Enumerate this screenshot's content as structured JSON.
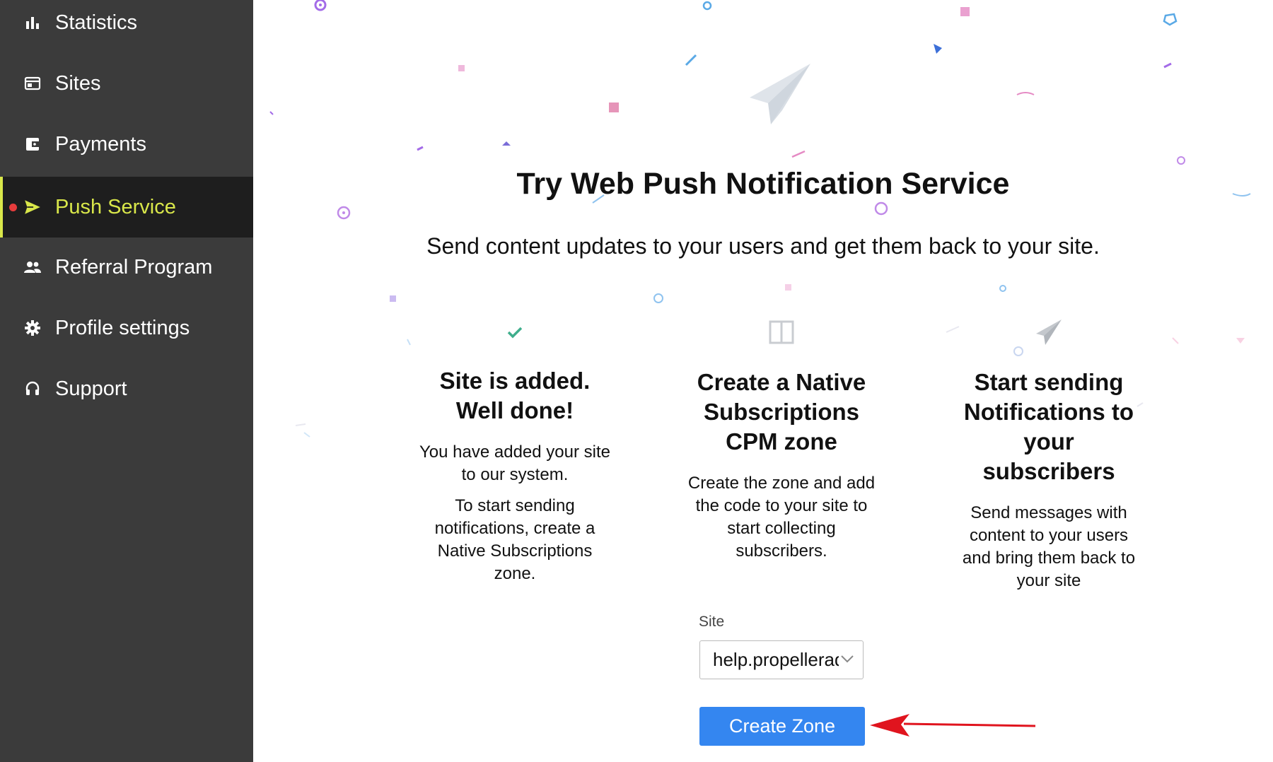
{
  "sidebar": {
    "items": [
      {
        "label": "Statistics",
        "icon": "bar-chart-icon"
      },
      {
        "label": "Sites",
        "icon": "browser-window-icon"
      },
      {
        "label": "Payments",
        "icon": "wallet-icon"
      },
      {
        "label": "Push Service",
        "icon": "send-arrow-icon",
        "active": true
      },
      {
        "label": "Referral Program",
        "icon": "people-icon"
      },
      {
        "label": "Profile settings",
        "icon": "gear-icon"
      },
      {
        "label": "Support",
        "icon": "headset-icon"
      }
    ]
  },
  "main": {
    "title": "Try Web Push Notification Service",
    "subtitle": "Send content updates to your users and get them back to your site.",
    "steps": [
      {
        "icon": "check-icon",
        "title_lines": [
          "Site is added.",
          "Well done!"
        ],
        "paragraphs": [
          "You have added your site to our system.",
          "To start sending notifications, create a Native Subscriptions zone."
        ]
      },
      {
        "icon": "panel-layout-icon",
        "title_lines": [
          "Create a Native",
          "Subscriptions",
          "CPM zone"
        ],
        "paragraphs": [
          "Create the zone and add the code to your site to start collecting subscribers."
        ]
      },
      {
        "icon": "paper-plane-icon",
        "title_lines": [
          "Start sending",
          "Notifications to",
          "your",
          "subscribers"
        ],
        "paragraphs": [
          "Send messages with content to your users and bring them back to your site"
        ]
      }
    ],
    "site_select": {
      "label": "Site",
      "value": "help.propellerads.com"
    },
    "create_button": "Create Zone"
  },
  "colors": {
    "sidebar_bg": "#3b3b3b",
    "sidebar_active_bg": "#1e1e1e",
    "active_accent": "#d9e74a",
    "active_dot": "#e63c3c",
    "button": "#3486f0",
    "annotation_arrow": "#e0141e",
    "check": "#3fae8c"
  }
}
